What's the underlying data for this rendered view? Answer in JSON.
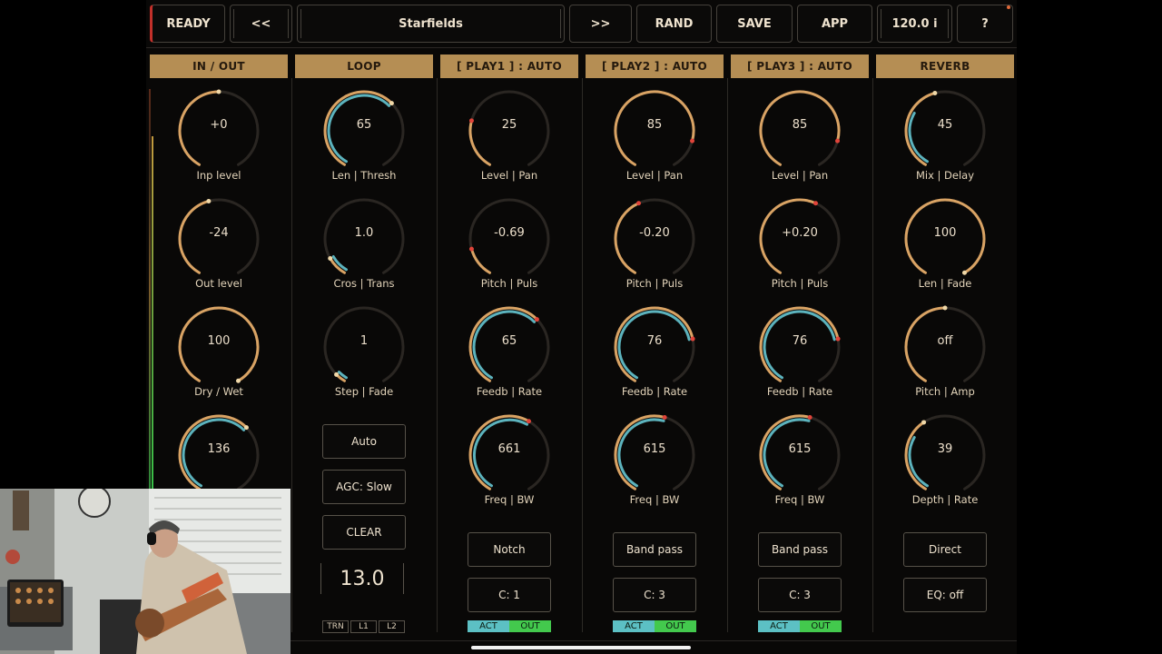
{
  "toolbar": {
    "ready": "READY",
    "prev": "<<",
    "preset_name": "Starfields",
    "next": ">>",
    "rand": "RAND",
    "save": "SAVE",
    "app": "APP",
    "tempo": "120.0 i",
    "help": "?"
  },
  "colors": {
    "accent_gold": "#b58e54",
    "arc_orange": "#d9a364",
    "arc_teal": "#5cb3bd",
    "marker_red": "#e0443a",
    "act_teal": "#5cc0c4",
    "out_green": "#43c94d"
  },
  "columns": [
    {
      "title": "IN / OUT",
      "knobs": [
        {
          "value": "+0",
          "label": "Inp level",
          "level": 0.5
        },
        {
          "value": "-24",
          "label": "Out level",
          "level": 0.45
        },
        {
          "value": "100",
          "label": "Dry / Wet",
          "level": 1.0
        },
        {
          "value": "136",
          "label": "",
          "level": 0.65,
          "teal": 0.65
        }
      ]
    },
    {
      "title": "LOOP",
      "knobs": [
        {
          "value": "65",
          "label": "Len | Thresh",
          "level": 0.65,
          "teal": 0.65
        },
        {
          "value": "1.0",
          "label": "Cros | Trans",
          "level": 0.1,
          "teal": 0.1
        },
        {
          "value": "1",
          "label": "Step | Fade",
          "level": 0.05,
          "teal": 0.05
        }
      ],
      "buttons": [
        "Auto",
        "AGC: Slow",
        "CLEAR"
      ],
      "counter": "13.0",
      "mini": [
        "TRN",
        "L1",
        "L2"
      ]
    },
    {
      "title": "[ PLAY1 ] : AUTO",
      "knobs": [
        {
          "value": "25",
          "label": "Level | Pan",
          "level": 0.25
        },
        {
          "value": "-0.69",
          "label": "Pitch | Puls",
          "level": 0.15
        },
        {
          "value": "65",
          "label": "Feedb | Rate",
          "level": 0.65,
          "teal": 0.65
        },
        {
          "value": "661",
          "label": "Freq | BW",
          "level": 0.6,
          "teal": 0.6
        }
      ],
      "buttons": [
        "Notch",
        "C: 1"
      ],
      "act": "ACT",
      "out": "OUT"
    },
    {
      "title": "[ PLAY2 ] : AUTO",
      "knobs": [
        {
          "value": "85",
          "label": "Level | Pan",
          "level": 0.85
        },
        {
          "value": "-0.20",
          "label": "Pitch | Puls",
          "level": 0.42
        },
        {
          "value": "76",
          "label": "Feedb | Rate",
          "level": 0.76,
          "teal": 0.76
        },
        {
          "value": "615",
          "label": "Freq | BW",
          "level": 0.55,
          "teal": 0.55
        }
      ],
      "buttons": [
        "Band pass",
        "C: 3"
      ],
      "act": "ACT",
      "out": "OUT"
    },
    {
      "title": "[ PLAY3 ] : AUTO",
      "knobs": [
        {
          "value": "85",
          "label": "Level | Pan",
          "level": 0.85
        },
        {
          "value": "+0.20",
          "label": "Pitch | Puls",
          "level": 0.58
        },
        {
          "value": "76",
          "label": "Feedb | Rate",
          "level": 0.76,
          "teal": 0.76
        },
        {
          "value": "615",
          "label": "Freq | BW",
          "level": 0.55,
          "teal": 0.55
        }
      ],
      "buttons": [
        "Band pass",
        "C: 3"
      ],
      "act": "ACT",
      "out": "OUT"
    },
    {
      "title": "REVERB",
      "knobs": [
        {
          "value": "45",
          "label": "Mix | Delay",
          "level": 0.45,
          "teal": 0.3
        },
        {
          "value": "100",
          "label": "Len | Fade",
          "level": 1.0
        },
        {
          "value": "off",
          "label": "Pitch | Amp",
          "level": 0.5
        },
        {
          "value": "39",
          "label": "Depth | Rate",
          "level": 0.39,
          "teal": 0.3
        }
      ],
      "buttons": [
        "Direct",
        "EQ: off"
      ]
    }
  ]
}
